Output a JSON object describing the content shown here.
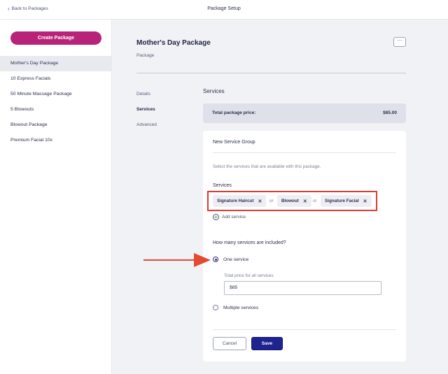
{
  "header": {
    "back_label": "Back to Packages",
    "title": "Package Setup"
  },
  "sidebar": {
    "create_label": "Create Package",
    "accent_color": "#b8237a",
    "items": [
      {
        "label": "Mother's Day Package",
        "active": true
      },
      {
        "label": "10 Express Facials"
      },
      {
        "label": "50 Minute Massage Package"
      },
      {
        "label": "5 Blowouts"
      },
      {
        "label": "Blowout Package"
      },
      {
        "label": "Premium Facial 10x"
      }
    ]
  },
  "package": {
    "title": "Mother's Day Package",
    "subtitle": "Package",
    "more_label": "···"
  },
  "subnav": [
    "Details",
    "Services",
    "Advanced"
  ],
  "services": {
    "heading": "Services",
    "total_label": "Total package price:",
    "total_value": "$85.00",
    "group_title": "New Service Group",
    "help_text": "Select the services that are available with this package.",
    "services_label": "Services",
    "chips": [
      "Signature Haircut",
      "Blowout",
      "Signature Facial"
    ],
    "or_label": "or",
    "add_label": "Add service",
    "question": "How many services are included?",
    "option_one": "One service",
    "option_multiple": "Multiple services",
    "selected_option": "One service",
    "price_label": "Total price for all services",
    "price_value": "$85",
    "cancel_label": "Cancel",
    "save_label": "Save",
    "save_color": "#1f2390",
    "highlight_color": "#e03b32"
  }
}
